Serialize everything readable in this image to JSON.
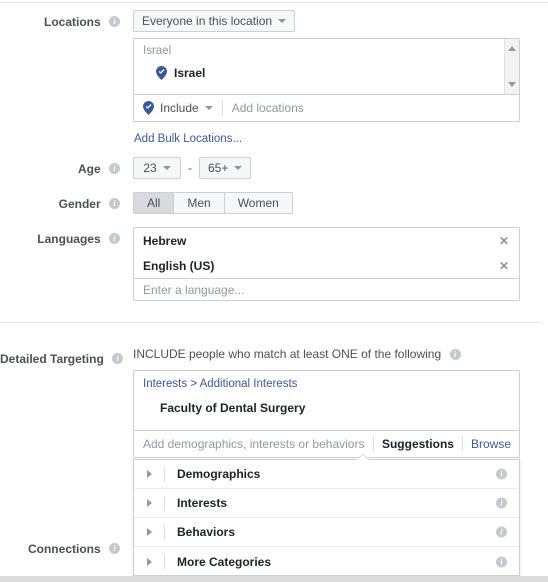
{
  "sections": {
    "locations": {
      "label": "Locations",
      "mode_selected": "Everyone in this location",
      "group_header": "Israel",
      "selected_location": "Israel",
      "include_label": "Include",
      "add_locations_placeholder": "Add locations",
      "add_bulk_link": "Add Bulk Locations...",
      "pin_icon": "map-pin-check-icon",
      "scroll_up_icon": "scroll-up-arrow-icon",
      "scroll_down_icon": "scroll-down-arrow-icon"
    },
    "age": {
      "label": "Age",
      "min": "23",
      "max": "65+",
      "separator": "-"
    },
    "gender": {
      "label": "Gender",
      "options": [
        {
          "label": "All",
          "selected": true
        },
        {
          "label": "Men",
          "selected": false
        },
        {
          "label": "Women",
          "selected": false
        }
      ]
    },
    "languages": {
      "label": "Languages",
      "items": [
        {
          "label": "Hebrew",
          "remove_icon": "close-icon"
        },
        {
          "label": "English (US)",
          "remove_icon": "close-icon"
        }
      ],
      "placeholder": "Enter a language..."
    },
    "detailed_targeting": {
      "label": "Detailed Targeting",
      "include_text": "INCLUDE people who match at least ONE of the following",
      "breadcrumb": {
        "root": "Interests",
        "separator": ">",
        "child": "Additional Interests"
      },
      "selected_term": "Faculty of Dental Surgery",
      "placeholder": "Add demographics, interests or behaviors",
      "suggestions_label": "Suggestions",
      "browse_label": "Browse",
      "browse_categories": [
        {
          "label": "Demographics",
          "expand_icon": "chevron-right-icon",
          "info_icon": "info-icon"
        },
        {
          "label": "Interests",
          "expand_icon": "chevron-right-icon",
          "info_icon": "info-icon"
        },
        {
          "label": "Behaviors",
          "expand_icon": "chevron-right-icon",
          "info_icon": "info-icon"
        },
        {
          "label": "More Categories",
          "expand_icon": "chevron-right-icon",
          "info_icon": "info-icon"
        }
      ]
    },
    "connections": {
      "label": "Connections"
    }
  },
  "colors": {
    "link": "#3b5998",
    "pin": "#3b5998",
    "label_text": "#4b4f56",
    "placeholder": "#9197a3",
    "border": "#ccd0d5",
    "selected_segment": "#d8dade",
    "button_bg": "#f6f7f8"
  }
}
